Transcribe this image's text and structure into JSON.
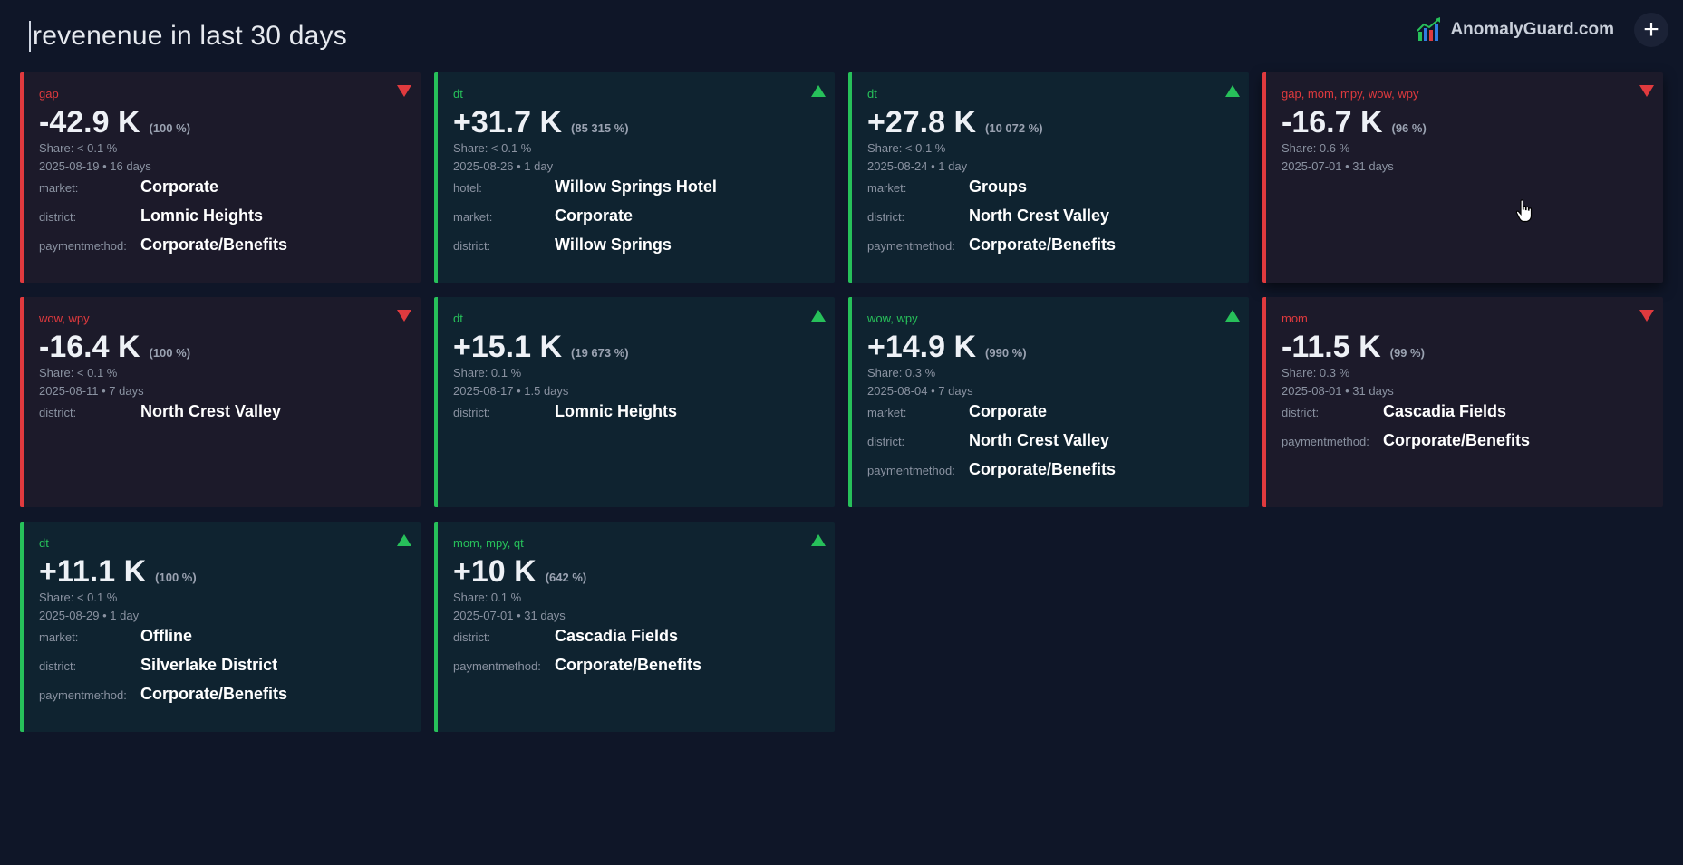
{
  "search": {
    "query": "revenenue in last 30 days"
  },
  "brand": {
    "name": "AnomalyGuard.com"
  },
  "colors": {
    "background": "#0f1628",
    "down": "#e03a3e",
    "up": "#27c05a",
    "card_down_bg": "#1c1a2a",
    "card_up_bg": "#0f2330"
  },
  "icons": {
    "logo": "bar-chart-trend-logo-icon",
    "add": "plus-icon",
    "down": "triangle-down-icon",
    "up": "triangle-up-icon"
  },
  "cards": [
    {
      "direction": "down",
      "tags": "gap",
      "value": "-42.9 K",
      "pct": "(100 %)",
      "share": "Share: < 0.1 %",
      "date": "2025-08-19 • 16 days",
      "dims": [
        {
          "key": "market:",
          "val": "Corporate"
        },
        {
          "key": "district:",
          "val": "Lomnic Heights"
        },
        {
          "key": "paymentmethod:",
          "val": "Corporate/Benefits"
        }
      ]
    },
    {
      "direction": "up",
      "tags": "dt",
      "value": "+31.7 K",
      "pct": "(85 315 %)",
      "share": "Share: < 0.1 %",
      "date": "2025-08-26 • 1 day",
      "dims": [
        {
          "key": "hotel:",
          "val": "Willow Springs Hotel"
        },
        {
          "key": "market:",
          "val": "Corporate"
        },
        {
          "key": "district:",
          "val": "Willow Springs"
        }
      ]
    },
    {
      "direction": "up",
      "tags": "dt",
      "value": "+27.8 K",
      "pct": "(10 072 %)",
      "share": "Share: < 0.1 %",
      "date": "2025-08-24 • 1 day",
      "dims": [
        {
          "key": "market:",
          "val": "Groups"
        },
        {
          "key": "district:",
          "val": "North Crest Valley"
        },
        {
          "key": "paymentmethod:",
          "val": "Corporate/Benefits"
        }
      ]
    },
    {
      "direction": "down",
      "tags": "gap, mom, mpy, wow, wpy",
      "value": "-16.7 K",
      "pct": "(96 %)",
      "share": "Share: 0.6 %",
      "date": "2025-07-01 • 31 days",
      "dims": []
    },
    {
      "direction": "down",
      "tags": "wow, wpy",
      "value": "-16.4 K",
      "pct": "(100 %)",
      "share": "Share: < 0.1 %",
      "date": "2025-08-11 • 7 days",
      "dims": [
        {
          "key": "district:",
          "val": "North Crest Valley"
        }
      ]
    },
    {
      "direction": "up",
      "tags": "dt",
      "value": "+15.1 K",
      "pct": "(19 673 %)",
      "share": "Share: 0.1 %",
      "date": "2025-08-17 • 1.5 days",
      "dims": [
        {
          "key": "district:",
          "val": "Lomnic Heights"
        }
      ]
    },
    {
      "direction": "up",
      "tags": "wow, wpy",
      "value": "+14.9 K",
      "pct": "(990 %)",
      "share": "Share: 0.3 %",
      "date": "2025-08-04 • 7 days",
      "dims": [
        {
          "key": "market:",
          "val": "Corporate"
        },
        {
          "key": "district:",
          "val": "North Crest Valley"
        },
        {
          "key": "paymentmethod:",
          "val": "Corporate/Benefits"
        }
      ]
    },
    {
      "direction": "down",
      "tags": "mom",
      "value": "-11.5 K",
      "pct": "(99 %)",
      "share": "Share: 0.3 %",
      "date": "2025-08-01 • 31 days",
      "dims": [
        {
          "key": "district:",
          "val": "Cascadia Fields"
        },
        {
          "key": "paymentmethod:",
          "val": "Corporate/Benefits"
        }
      ]
    },
    {
      "direction": "up",
      "tags": "dt",
      "value": "+11.1 K",
      "pct": "(100 %)",
      "share": "Share: < 0.1 %",
      "date": "2025-08-29 • 1 day",
      "dims": [
        {
          "key": "market:",
          "val": "Offline"
        },
        {
          "key": "district:",
          "val": "Silverlake District"
        },
        {
          "key": "paymentmethod:",
          "val": "Corporate/Benefits"
        }
      ]
    },
    {
      "direction": "up",
      "tags": "mom, mpy, qt",
      "value": "+10 K",
      "pct": "(642 %)",
      "share": "Share: 0.1 %",
      "date": "2025-07-01 • 31 days",
      "dims": [
        {
          "key": "district:",
          "val": "Cascadia Fields"
        },
        {
          "key": "paymentmethod:",
          "val": "Corporate/Benefits"
        }
      ]
    }
  ]
}
